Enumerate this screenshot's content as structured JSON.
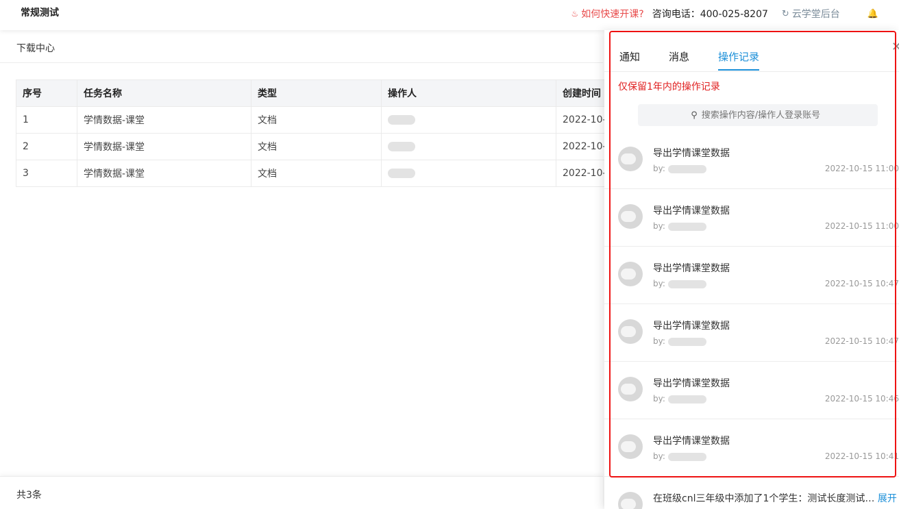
{
  "header": {
    "app_title": "常规测试",
    "quick_link": "如何快速开课?",
    "phone": "咨询电话：400-025-8207",
    "backend_link": "云学堂后台"
  },
  "breadcrumb": "下载中心",
  "table": {
    "columns": [
      "序号",
      "任务名称",
      "类型",
      "操作人",
      "创建时间"
    ],
    "rows": [
      [
        "1",
        "学情数据-课堂",
        "文档",
        "",
        "2022-10-"
      ],
      [
        "2",
        "学情数据-课堂",
        "文档",
        "",
        "2022-10-"
      ],
      [
        "3",
        "学情数据-课堂",
        "文档",
        "",
        "2022-10-"
      ]
    ]
  },
  "footer": {
    "total": "共3条"
  },
  "drawer": {
    "tabs": [
      "通知",
      "消息",
      "操作记录"
    ],
    "active_tab": 2,
    "notice": "仅保留1年内的操作记录",
    "search_placeholder": "搜索操作内容/操作人登录账号",
    "by_label": "by:",
    "records": [
      {
        "title": "导出学情课堂数据",
        "time": "2022-10-15 11:00"
      },
      {
        "title": "导出学情课堂数据",
        "time": "2022-10-15 11:00"
      },
      {
        "title": "导出学情课堂数据",
        "time": "2022-10-15 10:47"
      },
      {
        "title": "导出学情课堂数据",
        "time": "2022-10-15 10:47"
      },
      {
        "title": "导出学情课堂数据",
        "time": "2022-10-15 10:46"
      },
      {
        "title": "导出学情课堂数据",
        "time": "2022-10-15 10:41"
      }
    ],
    "last_record": {
      "title": "在班级cnl三年级中添加了1个学生：测试长度测试…",
      "expand": "展开"
    }
  },
  "colors": {
    "accent": "#1b8fd8",
    "warning_red": "#e02020",
    "highlight_frame": "#ee1111"
  },
  "icons": {
    "quick_link": "fire-icon",
    "backend_link": "refresh-icon",
    "bell": "bell-icon",
    "search": "search-icon",
    "close": "close-icon"
  }
}
